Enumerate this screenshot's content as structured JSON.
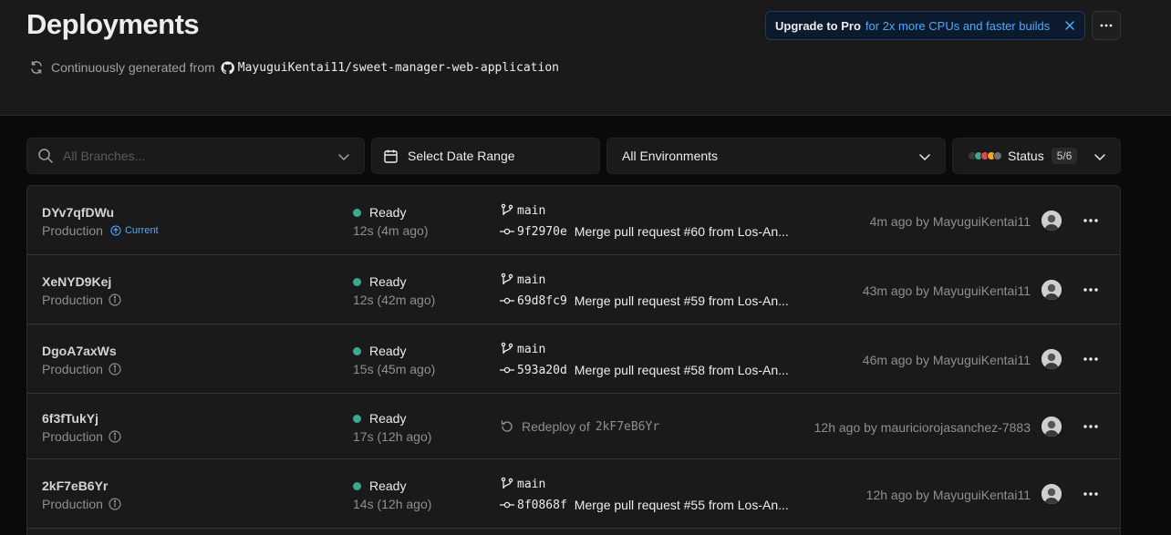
{
  "header": {
    "title": "Deployments",
    "source_label": "Continuously generated from",
    "repo": "MayuguiKentai11/sweet-manager-web-application",
    "upgrade_pro": "Upgrade to Pro",
    "upgrade_desc": "for 2x more CPUs and faster builds"
  },
  "filters": {
    "branch_placeholder": "All Branches...",
    "date_label": "Select Date Range",
    "env_label": "All Environments",
    "status_label": "Status",
    "status_count": "5/6",
    "status_colors": [
      "#3a3a3a",
      "#3ba88f",
      "#e5484d",
      "#f5a623",
      "#707070"
    ]
  },
  "deployments": [
    {
      "id": "DYv7qfDWu",
      "env": "Production",
      "badge": "Current",
      "status": "Ready",
      "duration": "12s (4m ago)",
      "branch": "main",
      "hash": "9f2970e",
      "message": "Merge pull request #60 from Los-An...",
      "by": "4m ago by MayuguiKentai11"
    },
    {
      "id": "XeNYD9Kej",
      "env": "Production",
      "status": "Ready",
      "duration": "12s (42m ago)",
      "branch": "main",
      "hash": "69d8fc9",
      "message": "Merge pull request #59 from Los-An...",
      "by": "43m ago by MayuguiKentai11"
    },
    {
      "id": "DgoA7axWs",
      "env": "Production",
      "status": "Ready",
      "duration": "15s (45m ago)",
      "branch": "main",
      "hash": "593a20d",
      "message": "Merge pull request #58 from Los-An...",
      "by": "46m ago by MayuguiKentai11"
    },
    {
      "id": "6f3fTukYj",
      "env": "Production",
      "status": "Ready",
      "duration": "17s (12h ago)",
      "redeploy_label": "Redeploy of",
      "redeploy_id": "2kF7eB6Yr",
      "by": "12h ago by mauriciorojasanchez-7883"
    },
    {
      "id": "2kF7eB6Yr",
      "env": "Production",
      "status": "Ready",
      "duration": "14s (12h ago)",
      "branch": "main",
      "hash": "8f0868f",
      "message": "Merge pull request #55 from Los-An...",
      "by": "12h ago by MayuguiKentai11"
    }
  ]
}
